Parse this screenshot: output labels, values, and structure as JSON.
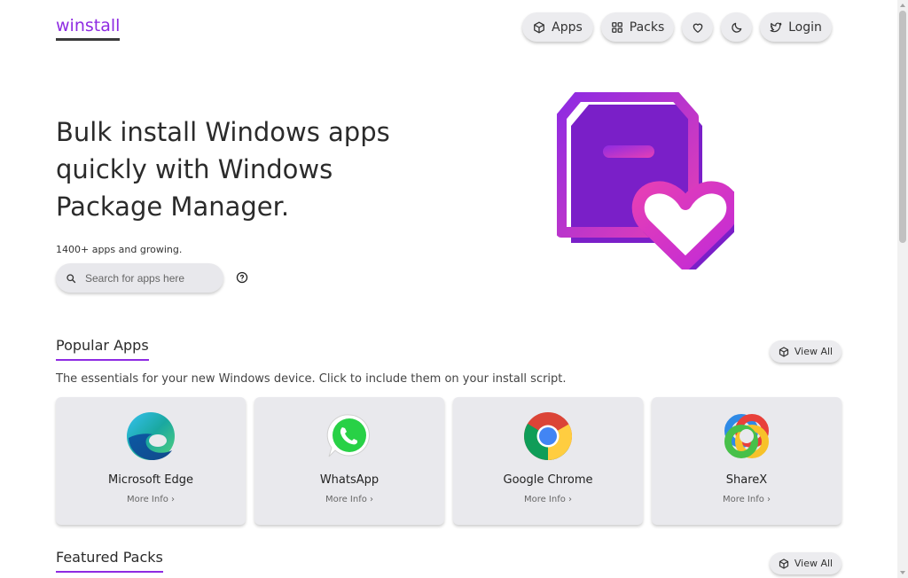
{
  "header": {
    "logo": "winstall",
    "nav": {
      "apps_label": "Apps",
      "packs_label": "Packs",
      "login_label": "Login"
    }
  },
  "hero": {
    "title": "Bulk install Windows apps quickly with Windows Package Manager.",
    "subtitle": "1400+ apps and growing.",
    "search_placeholder": "Search for apps here"
  },
  "popular": {
    "title": "Popular Apps",
    "view_all": "View All",
    "description": "The essentials for your new Windows device. Click to include them on your install script.",
    "apps": [
      {
        "name": "Microsoft Edge",
        "more": "More Info"
      },
      {
        "name": "WhatsApp",
        "more": "More Info"
      },
      {
        "name": "Google Chrome",
        "more": "More Info"
      },
      {
        "name": "ShareX",
        "more": "More Info"
      }
    ]
  },
  "featured": {
    "title": "Featured Packs",
    "view_all": "View All"
  },
  "colors": {
    "brand_purple": "#8e2be2",
    "brand_pink": "#e63fb5",
    "button_bg": "#ececef",
    "card_bg": "#e9e9ed"
  },
  "icons": {
    "apps": "cube-icon",
    "packs": "grid-icon",
    "favorites": "heart-icon",
    "theme": "moon-icon",
    "login": "twitter-bird-icon",
    "search": "search-icon",
    "help": "help-circle-icon",
    "view_all": "cube-icon"
  }
}
